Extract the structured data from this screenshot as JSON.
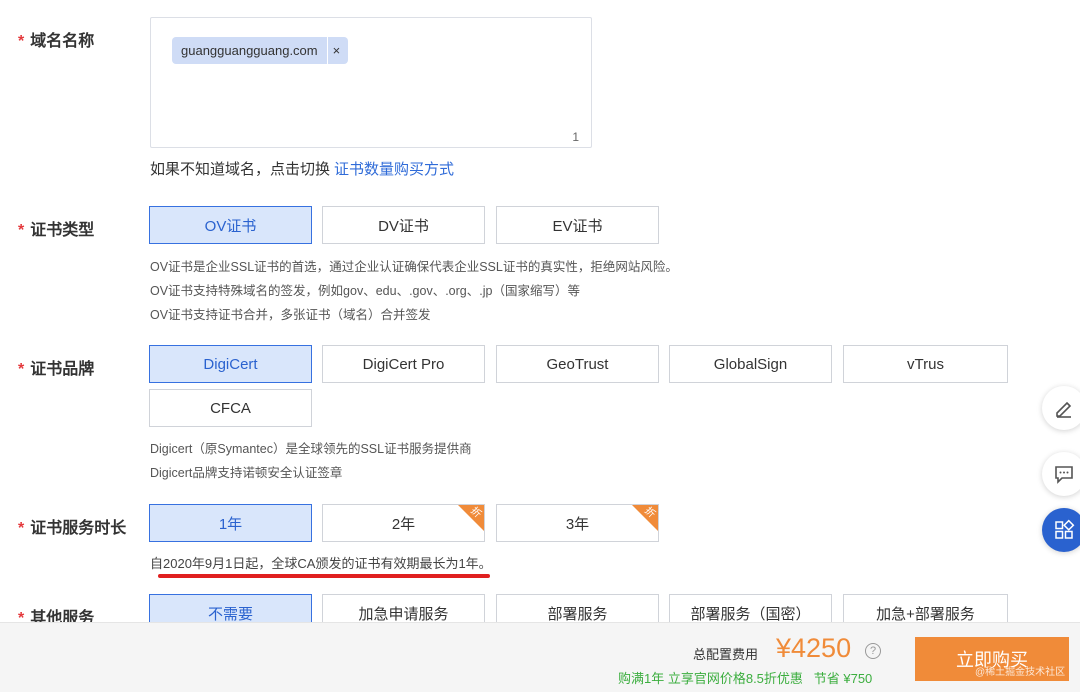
{
  "domain": {
    "label": "域名名称",
    "required_mark": "*",
    "tag": "guangguangguang.com",
    "tag_close": "×",
    "count": "1",
    "hint_text": "如果不知道域名，点击切换",
    "hint_link": "证书数量购买方式"
  },
  "cert_type": {
    "label": "证书类型",
    "options": [
      "OV证书",
      "DV证书",
      "EV证书"
    ],
    "selected": "OV证书",
    "desc": [
      "OV证书是企业SSL证书的首选，通过企业认证确保代表企业SSL证书的真实性，拒绝网站风险。",
      "OV证书支持特殊域名的签发，例如gov、edu、.gov、.org、.jp（国家缩写）等",
      "OV证书支持证书合并，多张证书（域名）合并签发"
    ]
  },
  "brand": {
    "label": "证书品牌",
    "options": [
      "DigiCert",
      "DigiCert Pro",
      "GeoTrust",
      "GlobalSign",
      "vTrus",
      "CFCA"
    ],
    "selected": "DigiCert",
    "desc": [
      "Digicert（原Symantec）是全球领先的SSL证书服务提供商",
      "Digicert品牌支持诺顿安全认证签章"
    ]
  },
  "duration": {
    "label": "证书服务时长",
    "options": [
      "1年",
      "2年",
      "3年"
    ],
    "selected": "1年",
    "corner_badge": "折",
    "note": "自2020年9月1日起，全球CA颁发的证书有效期最长为1年。"
  },
  "other": {
    "label": "其他服务",
    "options": [
      "不需要",
      "加急申请服务",
      "部署服务",
      "部署服务（国密）",
      "加急+部署服务"
    ],
    "selected": "不需要"
  },
  "footer": {
    "total_label": "总配置费用",
    "price": "¥4250",
    "help": "?",
    "promo": "购满1年 立享官网价格8.5折优惠   节省 ¥750",
    "buy_label": "立即购买",
    "watermark": "@稀土掘金技术社区"
  },
  "side": {
    "icons": [
      "edit-icon",
      "feedback-icon",
      "apps-icon"
    ]
  },
  "colors": {
    "accent": "#2a62cf",
    "selected_bg": "#d9e6fb",
    "price": "#f08b39",
    "promo": "#3cae3f",
    "required": "#e4393c"
  }
}
